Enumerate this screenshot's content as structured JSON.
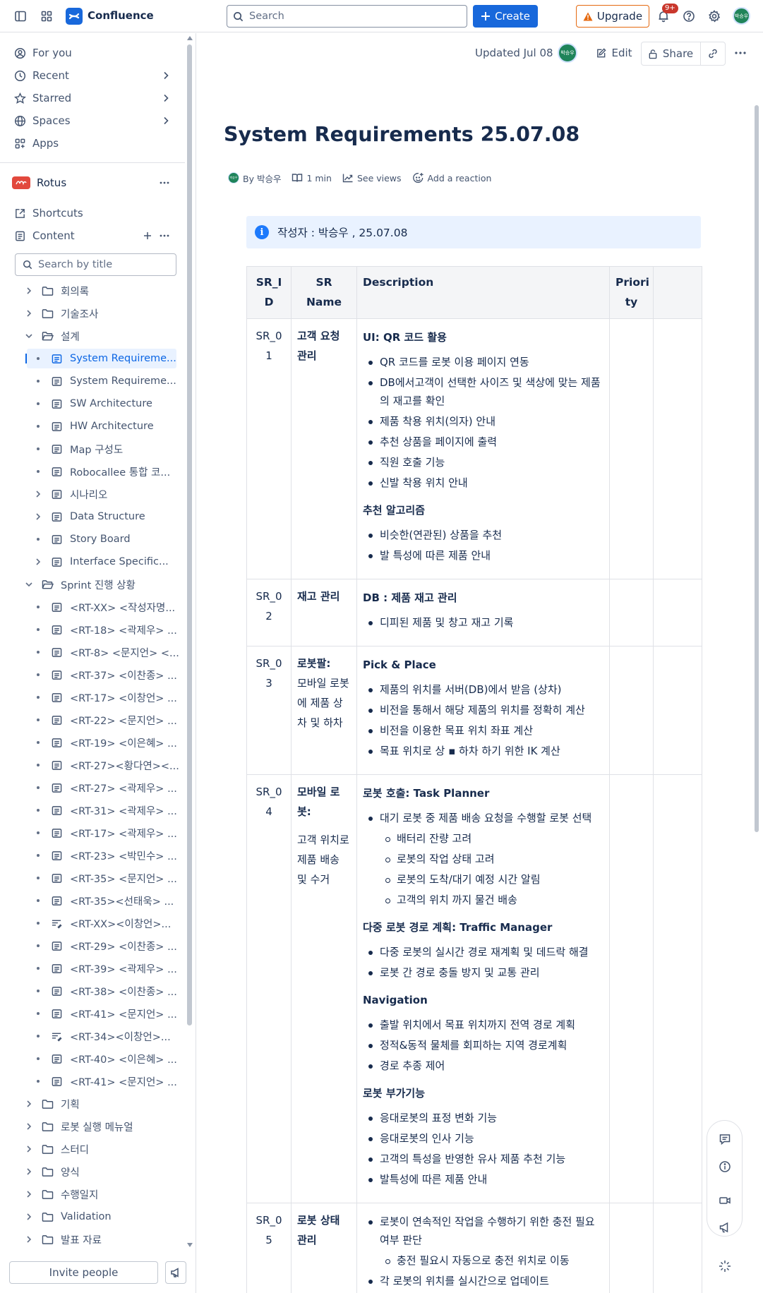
{
  "topbar": {
    "app_name": "Confluence",
    "search_placeholder": "Search",
    "create_label": "Create",
    "upgrade_label": "Upgrade",
    "notification_count": "9+",
    "avatar_initials": "박승우"
  },
  "sidebar": {
    "nav": [
      {
        "label": "For you",
        "icon": "person-circle-icon"
      },
      {
        "label": "Recent",
        "icon": "clock-icon"
      },
      {
        "label": "Starred",
        "icon": "star-icon"
      },
      {
        "label": "Spaces",
        "icon": "globe-icon"
      },
      {
        "label": "Apps",
        "icon": "apps-icon"
      }
    ],
    "space_name": "Rotus",
    "shortcuts_label": "Shortcuts",
    "content_label": "Content",
    "title_search_placeholder": "Search by title",
    "tree": [
      {
        "label": "회의록",
        "type": "folder",
        "level": 0,
        "expand": "collapsed"
      },
      {
        "label": "기술조사",
        "type": "folder",
        "level": 0,
        "expand": "collapsed"
      },
      {
        "label": "설계",
        "type": "folder",
        "level": 0,
        "expand": "expanded"
      },
      {
        "label": "System Requireme...",
        "type": "page",
        "level": 1,
        "expand": "none",
        "selected": true
      },
      {
        "label": "System Requireme...",
        "type": "page",
        "level": 1,
        "expand": "none"
      },
      {
        "label": "SW Architecture",
        "type": "page",
        "level": 1,
        "expand": "none"
      },
      {
        "label": "HW Architecture",
        "type": "page",
        "level": 1,
        "expand": "none"
      },
      {
        "label": "Map 구성도",
        "type": "page",
        "level": 1,
        "expand": "none"
      },
      {
        "label": "Robocallee 통합 코...",
        "type": "page",
        "level": 1,
        "expand": "none"
      },
      {
        "label": "시나리오",
        "type": "page",
        "level": 1,
        "expand": "collapsed"
      },
      {
        "label": "Data Structure",
        "type": "page",
        "level": 1,
        "expand": "collapsed"
      },
      {
        "label": "Story Board",
        "type": "page",
        "level": 1,
        "expand": "none"
      },
      {
        "label": "Interface Specific...",
        "type": "page",
        "level": 1,
        "expand": "collapsed"
      },
      {
        "label": "Sprint 진행 상황",
        "type": "folder",
        "level": 0,
        "expand": "expanded"
      },
      {
        "label": "<RT-XX> <작성자명...",
        "type": "page",
        "level": 1,
        "expand": "none"
      },
      {
        "label": "<RT-18> <곽제우> ...",
        "type": "page",
        "level": 1,
        "expand": "none"
      },
      {
        "label": "<RT-8> <문지언> <...",
        "type": "page",
        "level": 1,
        "expand": "none"
      },
      {
        "label": "<RT-37> <이찬종> ...",
        "type": "page",
        "level": 1,
        "expand": "none"
      },
      {
        "label": "<RT-17> <이창언> ...",
        "type": "page",
        "level": 1,
        "expand": "none"
      },
      {
        "label": "<RT-22> <문지언> ...",
        "type": "page",
        "level": 1,
        "expand": "none"
      },
      {
        "label": "<RT-19> <이은혜> ...",
        "type": "page",
        "level": 1,
        "expand": "none"
      },
      {
        "label": "<RT-27><황다연><...",
        "type": "page",
        "level": 1,
        "expand": "none"
      },
      {
        "label": "<RT-27> <곽제우> ...",
        "type": "page",
        "level": 1,
        "expand": "none"
      },
      {
        "label": "<RT-31> <곽제우> ...",
        "type": "page",
        "level": 1,
        "expand": "none"
      },
      {
        "label": "<RT-17> <곽제우> ...",
        "type": "page",
        "level": 1,
        "expand": "none"
      },
      {
        "label": "<RT-23> <박민수> ...",
        "type": "page",
        "level": 1,
        "expand": "none"
      },
      {
        "label": "<RT-35> <문지언> ...",
        "type": "page",
        "level": 1,
        "expand": "none"
      },
      {
        "label": "<RT-35><선태욱> ...",
        "type": "page",
        "level": 1,
        "expand": "none"
      },
      {
        "label": "<RT-XX><이창언>...",
        "type": "draft",
        "level": 1,
        "expand": "none"
      },
      {
        "label": "<RT-29> <이찬종> ...",
        "type": "page",
        "level": 1,
        "expand": "none"
      },
      {
        "label": "<RT-39> <곽제우> ...",
        "type": "page",
        "level": 1,
        "expand": "none"
      },
      {
        "label": "<RT-38> <이찬종> ...",
        "type": "page",
        "level": 1,
        "expand": "none"
      },
      {
        "label": "<RT-41> <문지언> ...",
        "type": "page",
        "level": 1,
        "expand": "none"
      },
      {
        "label": "<RT-34><이창언>...",
        "type": "draft",
        "level": 1,
        "expand": "none"
      },
      {
        "label": "<RT-40> <이은혜> ...",
        "type": "page",
        "level": 1,
        "expand": "none"
      },
      {
        "label": "<RT-41> <문지언> ...",
        "type": "page",
        "level": 1,
        "expand": "none"
      },
      {
        "label": "기획",
        "type": "folder",
        "level": 0,
        "expand": "collapsed"
      },
      {
        "label": "로봇 실행 메뉴얼",
        "type": "folder",
        "level": 0,
        "expand": "collapsed"
      },
      {
        "label": "스터디",
        "type": "folder",
        "level": 0,
        "expand": "collapsed"
      },
      {
        "label": "양식",
        "type": "folder",
        "level": 0,
        "expand": "collapsed"
      },
      {
        "label": "수행일지",
        "type": "folder",
        "level": 0,
        "expand": "collapsed"
      },
      {
        "label": "Validation",
        "type": "folder",
        "level": 0,
        "expand": "collapsed"
      },
      {
        "label": "발표 자료",
        "type": "folder",
        "level": 0,
        "expand": "collapsed"
      }
    ],
    "invite_label": "Invite people"
  },
  "page": {
    "updated": "Updated Jul 08",
    "edit_label": "Edit",
    "share_label": "Share",
    "title": "System Requirements 25.07.08",
    "byline": {
      "author": "By 박승우",
      "read_time": "1 min",
      "views": "See views",
      "reaction": "Add a reaction"
    },
    "info_text": "작성자 : 박승우 , 25.07.08",
    "table": {
      "headers": [
        "SR_I\nD",
        "SR Name",
        "Description",
        "Priori\nty",
        ""
      ],
      "rows": [
        {
          "id": "SR_01",
          "name": "고객 요청 관리",
          "name_note": "",
          "sections": [
            {
              "title": "UI: QR 코드 활용",
              "items": [
                {
                  "text": "QR 코드를 로봇 이용 페이지 연동"
                },
                {
                  "text": "DB에서고객이 선택한 사이즈 및 색상에 맞는 제품의 재고를 확인"
                },
                {
                  "text": "제품 착용 위치(의자) 안내"
                },
                {
                  "text": "추천 상품을 페이지에 출력"
                },
                {
                  "text": "직원 호출 기능"
                },
                {
                  "text": "신발 착용 위치 안내"
                }
              ]
            },
            {
              "title": "추천 알고리즘",
              "items": [
                {
                  "text": "비슷한(연관된) 상품을 추천"
                },
                {
                  "text": "발 특성에 따른 제품 안내"
                }
              ]
            }
          ]
        },
        {
          "id": "SR_02",
          "name": "재고 관리",
          "name_note": "",
          "sections": [
            {
              "title": "DB : 제품 재고 관리",
              "items": [
                {
                  "text": "디피된 제품 및 창고 재고 기록"
                }
              ]
            }
          ]
        },
        {
          "id": "SR_03",
          "name": "로봇팔:",
          "name_note": "모바일 로봇에 제품 상차 및 하차",
          "sections": [
            {
              "title": "Pick & Place",
              "items": [
                {
                  "text": "제품의 위치를 서버(DB)에서 받음 (상차)"
                },
                {
                  "text": "비전을 통해서 해당 제품의 위치를 정확히 계산"
                },
                {
                  "text": "비전을 이용한 목표 위치 좌표 계산"
                },
                {
                  "text": "목표 위치로 상 ▪ 하차 하기 위한 IK 계산"
                }
              ]
            }
          ]
        },
        {
          "id": "SR_04",
          "name": "모바일 로봇:",
          "name_note": "고객 위치로 제품 배송 및 수거",
          "sections": [
            {
              "title": "로봇 호출: Task Planner",
              "items": [
                {
                  "text": "대기 로봇 중 제품 배송 요청을 수행할 로봇 선택",
                  "sub": [
                    "배터리 잔량 고려",
                    "로봇의 작업 상태 고려",
                    "로봇의 도착/대기 예정 시간 알림",
                    "고객의 위치 까지 물건 배송"
                  ]
                }
              ]
            },
            {
              "title": "다중 로봇 경로 계획: Traffic Manager",
              "items": [
                {
                  "text": "다중 로봇의 실시간 경로 재계획 및 데드락 해결"
                },
                {
                  "text": "로봇 간 경로 충돌 방지 및 교통 관리"
                }
              ]
            },
            {
              "title": "Navigation",
              "items": [
                {
                  "text": "출발 위치에서 목표 위치까지 전역 경로 계획"
                },
                {
                  "text": "정적&동적 물체를 회피하는 지역 경로계획"
                },
                {
                  "text": "경로 추종 제어"
                }
              ]
            },
            {
              "title": "로봇 부가기능",
              "items": [
                {
                  "text": "응대로봇의 표정 변화 기능"
                },
                {
                  "text": "응대로봇의 인사 기능"
                },
                {
                  "text": "고객의 특성을 반영한 유사 제품 추천 기능"
                },
                {
                  "text": "발특성에 따른 제품 안내"
                }
              ]
            }
          ]
        },
        {
          "id": "SR_05",
          "name": "로봇 상태 관리",
          "name_note": "",
          "sections": [
            {
              "title": "",
              "items": [
                {
                  "text": "로봇이 연속적인 작업을 수행하기 위한 충전 필요 여부 판단",
                  "sub": [
                    "충전 필요시 자동으로 충전 위치로 이동"
                  ]
                },
                {
                  "text": "각 로봇의 위치를 실시간으로 업데이트"
                }
              ]
            }
          ]
        }
      ]
    }
  }
}
